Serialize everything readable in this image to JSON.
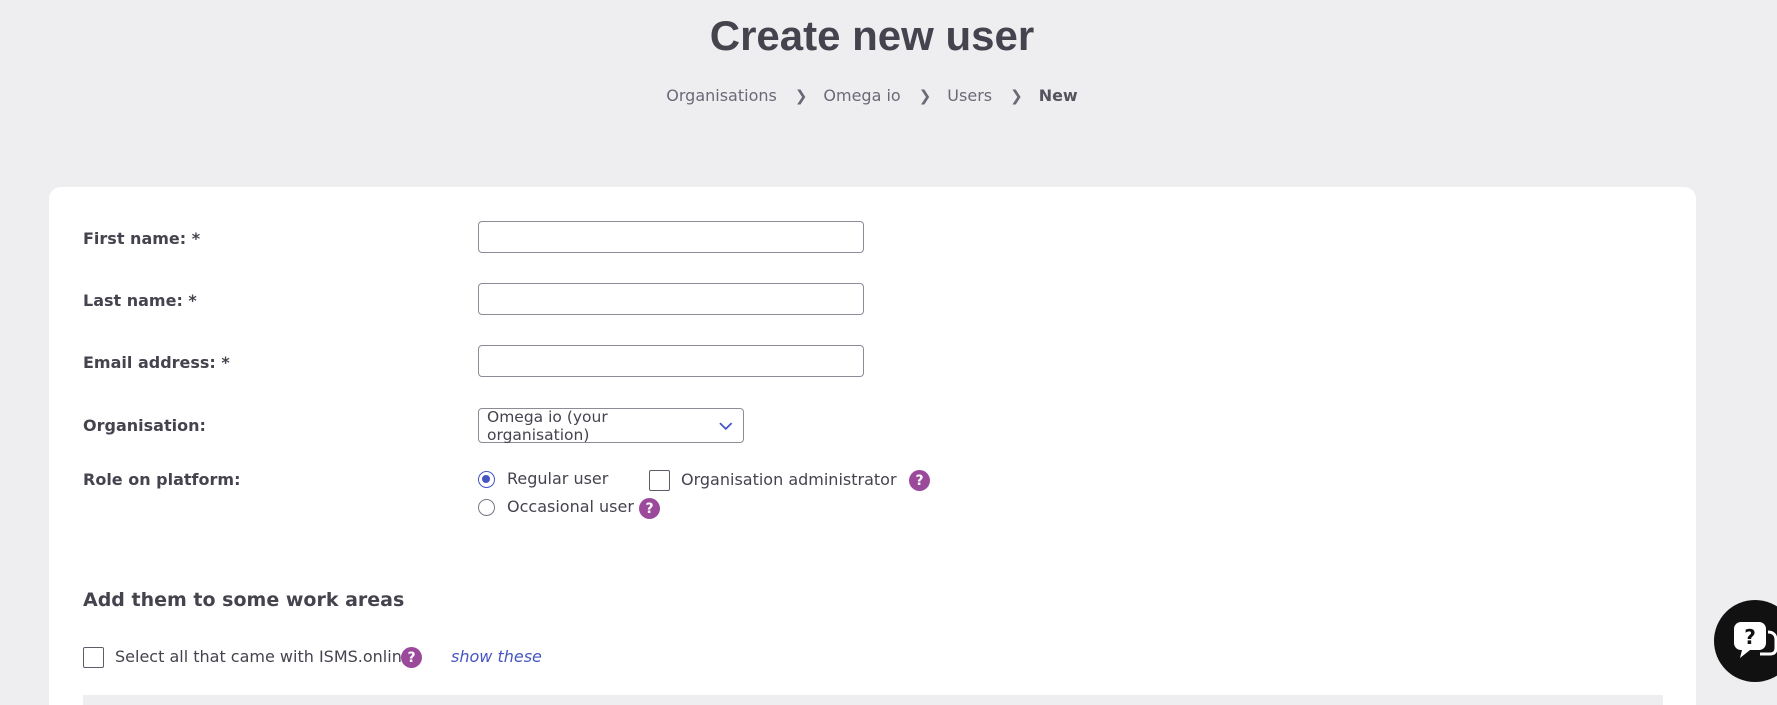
{
  "header": {
    "title": "Create new user"
  },
  "breadcrumb": {
    "items": [
      "Organisations",
      "Omega io",
      "Users"
    ],
    "current": "New"
  },
  "form": {
    "first_name_label": "First name: *",
    "last_name_label": "Last name: *",
    "email_label": "Email address: *",
    "organisation_label": "Organisation:",
    "organisation_value": "Omega io (your organisation)",
    "role_label": "Role on platform:",
    "role_regular": "Regular user",
    "role_occasional": "Occasional user",
    "role_admin": "Organisation administrator",
    "help_glyph": "?"
  },
  "work_areas": {
    "title": "Add them to some work areas",
    "select_all_label": "Select all that came with ISMS.online",
    "show_link": "show these"
  },
  "colors": {
    "background": "#eeeef1",
    "card": "#ffffff",
    "accent": "#4655c2",
    "help": "#9b4a9b"
  },
  "icons": {
    "breadcrumb_separator": "chevron-right-icon",
    "select": "chevron-down-icon",
    "help": "question-mark-icon",
    "chat": "chat-help-icon"
  }
}
